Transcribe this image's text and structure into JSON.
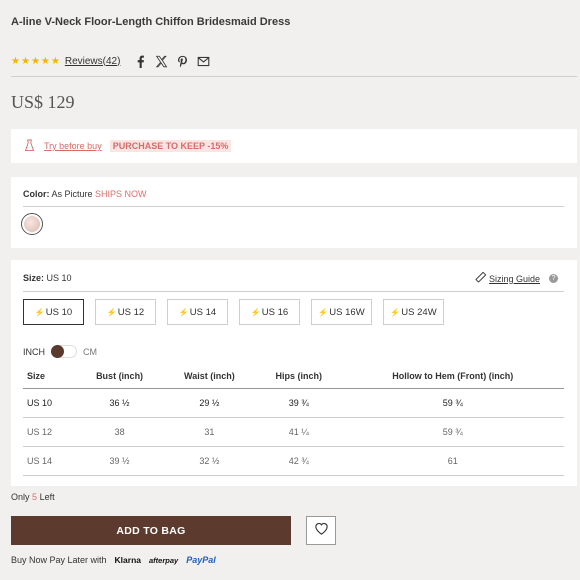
{
  "product": {
    "title": "A-line V-Neck Floor-Length Chiffon Bridesmaid Dress",
    "rating": 5,
    "reviews_label": "Reviews(42)",
    "price": "US$ 129"
  },
  "try": {
    "link_label": "Try before buy",
    "badge_label": "PURCHASE TO KEEP -15%"
  },
  "color": {
    "label": "Color:",
    "value": "As Picture",
    "ship_label": "SHIPS NOW"
  },
  "size": {
    "label": "Size:",
    "value": "US 10",
    "guide_label": "Sizing Guide",
    "options": [
      "US 10",
      "US 12",
      "US 14",
      "US 16",
      "US 16W",
      "US 24W"
    ],
    "selected": "US 10"
  },
  "units": {
    "inch_label": "INCH",
    "cm_label": "CM"
  },
  "size_table": {
    "headers": [
      "Size",
      "Bust (inch)",
      "Waist (inch)",
      "Hips (inch)",
      "Hollow to Hem (Front) (inch)"
    ],
    "rows": [
      [
        "US 10",
        "36 ½",
        "29 ½",
        "39 ¾",
        "59 ¾"
      ],
      [
        "US 12",
        "38",
        "31",
        "41 ¼",
        "59 ¾"
      ],
      [
        "US 14",
        "39 ½",
        "32 ½",
        "42 ¾",
        "61"
      ]
    ]
  },
  "stock": {
    "prefix": "Only",
    "count": "5",
    "suffix": "Left"
  },
  "cart": {
    "add_label": "ADD TO BAG"
  },
  "bnpl": {
    "label": "Buy Now Pay Later with",
    "providers": [
      "Klarna",
      "afterpay",
      "PayPal"
    ]
  },
  "colors": {
    "accent": "#e06d6d",
    "button": "#5c3b2e",
    "star": "#f4b400"
  }
}
